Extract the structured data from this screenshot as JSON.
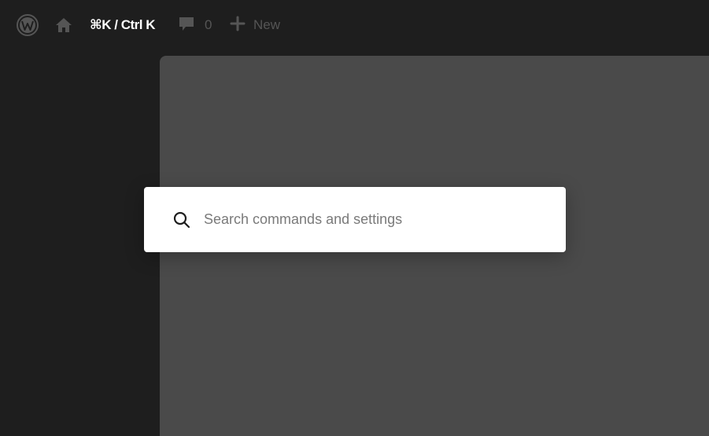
{
  "admin_bar": {
    "logo_icon": "wordpress-logo-icon",
    "home_icon": "home-icon",
    "shortcut_hint": "⌘K / Ctrl K",
    "comments": {
      "icon": "comment-bubble-icon",
      "count": "0"
    },
    "new": {
      "icon": "plus-icon",
      "label": "New"
    }
  },
  "command_palette": {
    "search_icon": "search-icon",
    "value": "",
    "placeholder": "Search commands and settings"
  },
  "colors": {
    "admin_bar_bg": "#1e1e1e",
    "canvas_bg": "#4a4a4a",
    "muted_icon": "#555555",
    "palette_bg": "#ffffff"
  }
}
